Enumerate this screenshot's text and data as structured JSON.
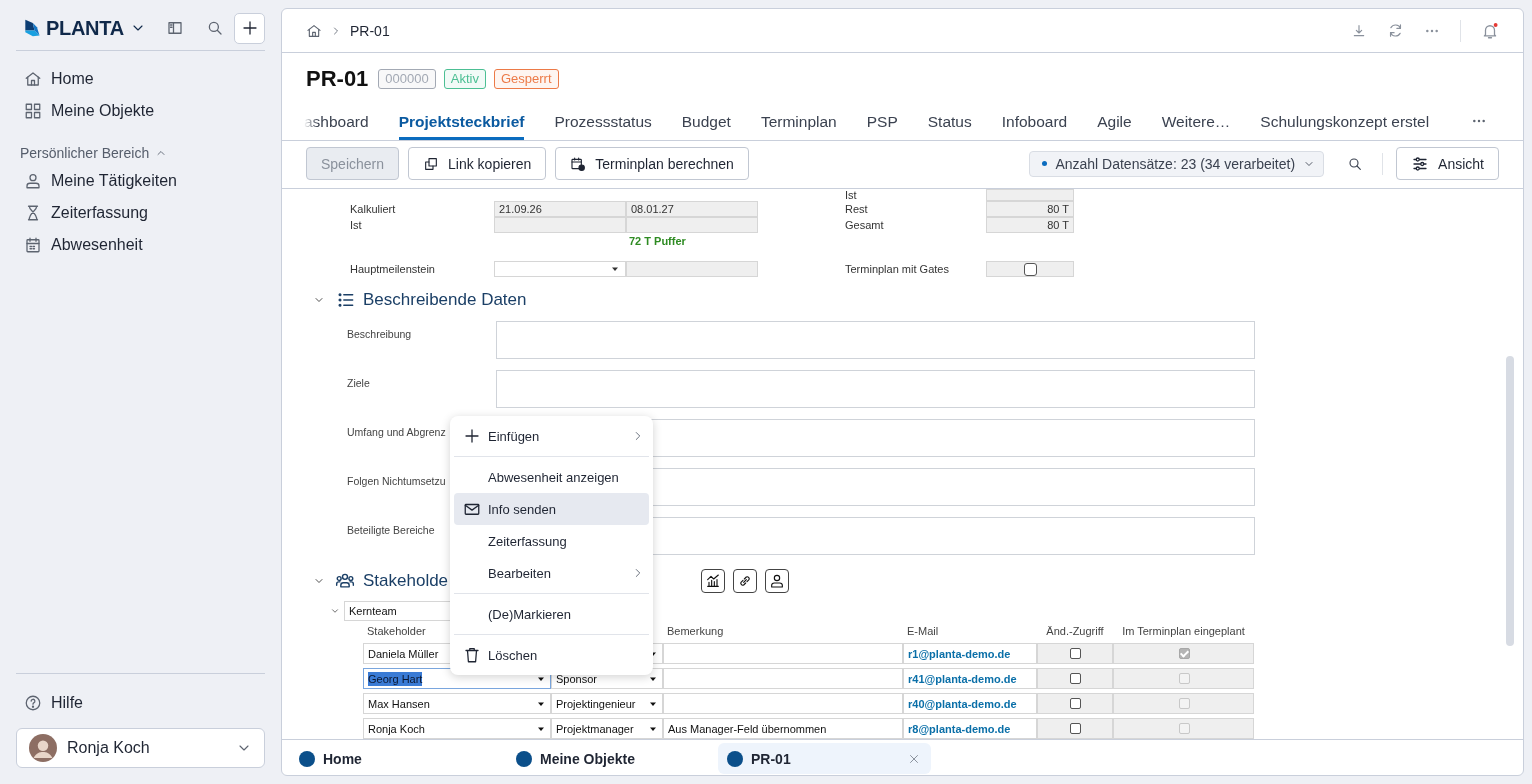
{
  "sidebar": {
    "brand": "PLANTA",
    "nav": [
      {
        "label": "Home"
      },
      {
        "label": "Meine Objekte"
      }
    ],
    "section": {
      "title": "Persönlicher Bereich",
      "expanded": true,
      "items": [
        {
          "label": "Meine Tätigkeiten"
        },
        {
          "label": "Zeiterfassung"
        },
        {
          "label": "Abwesenheit"
        }
      ]
    },
    "help": "Hilfe",
    "user": "Ronja Koch"
  },
  "breadcrumb": "PR-01",
  "object": {
    "title": "PR-01",
    "badges": [
      {
        "text": "000000",
        "color": "#a3a9b4"
      },
      {
        "text": "Aktiv",
        "color": "#4cbf94"
      },
      {
        "text": "Gesperrt",
        "color": "#ec7a48"
      }
    ]
  },
  "tabs": [
    {
      "label": "ashboard",
      "selected": false
    },
    {
      "label": "Projektsteckbrief",
      "selected": true
    },
    {
      "label": "Prozessstatus",
      "selected": false
    },
    {
      "label": "Budget",
      "selected": false
    },
    {
      "label": "Terminplan",
      "selected": false
    },
    {
      "label": "PSP",
      "selected": false
    },
    {
      "label": "Status",
      "selected": false
    },
    {
      "label": "Infoboard",
      "selected": false
    },
    {
      "label": "Agile",
      "selected": false
    },
    {
      "label": "Weitere…",
      "selected": false
    },
    {
      "label": "Schulungskonzept erstel",
      "selected": false
    }
  ],
  "toolbar": {
    "buttons": [
      {
        "label": "Speichern",
        "disabled": true
      },
      {
        "label": "Link kopieren",
        "disabled": false
      },
      {
        "label": "Terminplan berechnen",
        "disabled": false
      }
    ],
    "records": "Anzahl Datensätze: 23 (34 verarbeitet)",
    "view_button": "Ansicht"
  },
  "schedule": {
    "rows": [
      {
        "label": "Kalkuliert",
        "start": "21.09.26",
        "end": "08.01.27"
      },
      {
        "label": "Ist"
      }
    ],
    "buffer": "72 T Puffer",
    "milestone": {
      "label": "Hauptmeilenstein"
    },
    "effort": [
      {
        "label": "Ist"
      },
      {
        "label": "Rest",
        "value": "80 T"
      },
      {
        "label": "Gesamt",
        "value": "80 T"
      }
    ],
    "gates": {
      "label": "Terminplan mit Gates",
      "checked": false
    }
  },
  "descriptive": {
    "title": "Beschreibende Daten",
    "expanded": true,
    "fields": [
      {
        "label": "Beschreibung"
      },
      {
        "label": "Ziele"
      },
      {
        "label": "Umfang und Abgrenz"
      },
      {
        "label": "Folgen Nichtumsetzu"
      },
      {
        "label": "Beteiligte Bereiche"
      }
    ]
  },
  "stakeholders": {
    "title": "Stakeholde",
    "expanded": true,
    "group": {
      "name": "Kernteam",
      "expanded": true
    },
    "columns": {
      "stakeholder": "Stakeholder",
      "remark": "Bemerkung",
      "email": "E-Mail",
      "change_access": "Änd.-Zugriff",
      "planned": "Im Terminplan eingeplant"
    },
    "rows": [
      {
        "name": "Daniela Müller",
        "email": "r1@planta-demo.de",
        "change_access": false,
        "planned": true,
        "selected": false
      },
      {
        "name": "Georg Hart",
        "role": "Sponsor",
        "email": "r41@planta-demo.de",
        "change_access": false,
        "planned": false,
        "selected": true
      },
      {
        "name": "Max Hansen",
        "role": "Projektingenieur",
        "email": "r40@planta-demo.de",
        "change_access": false,
        "planned": false,
        "selected": false
      },
      {
        "name": "Ronja Koch",
        "role": "Projektmanager",
        "remark": "Aus Manager-Feld übernommen",
        "email": "r8@planta-demo.de",
        "change_access": false,
        "planned": false,
        "selected": false
      }
    ]
  },
  "context_menu": {
    "groups": [
      {
        "items": [
          {
            "label": "Einfügen",
            "kind": "add",
            "submenu": true,
            "selected": false
          }
        ]
      },
      {
        "items": [
          {
            "label": "Abwesenheit anzeigen",
            "kind": "plain",
            "submenu": false,
            "selected": false
          },
          {
            "label": "Info senden",
            "kind": "mail",
            "submenu": false,
            "selected": true
          },
          {
            "label": "Zeiterfassung",
            "kind": "plain",
            "submenu": false,
            "selected": false
          },
          {
            "label": "Bearbeiten",
            "kind": "plain",
            "submenu": true,
            "selected": false
          }
        ]
      },
      {
        "items": [
          {
            "label": "(De)Markieren",
            "kind": "plain",
            "submenu": false,
            "selected": false
          }
        ]
      },
      {
        "items": [
          {
            "label": "Löschen",
            "kind": "delete",
            "submenu": false,
            "selected": false
          }
        ]
      }
    ]
  },
  "doc_tabs": [
    {
      "label": "Home",
      "selected": false
    },
    {
      "label": "Meine Objekte",
      "selected": false
    },
    {
      "label": "PR-01",
      "selected": true
    }
  ]
}
